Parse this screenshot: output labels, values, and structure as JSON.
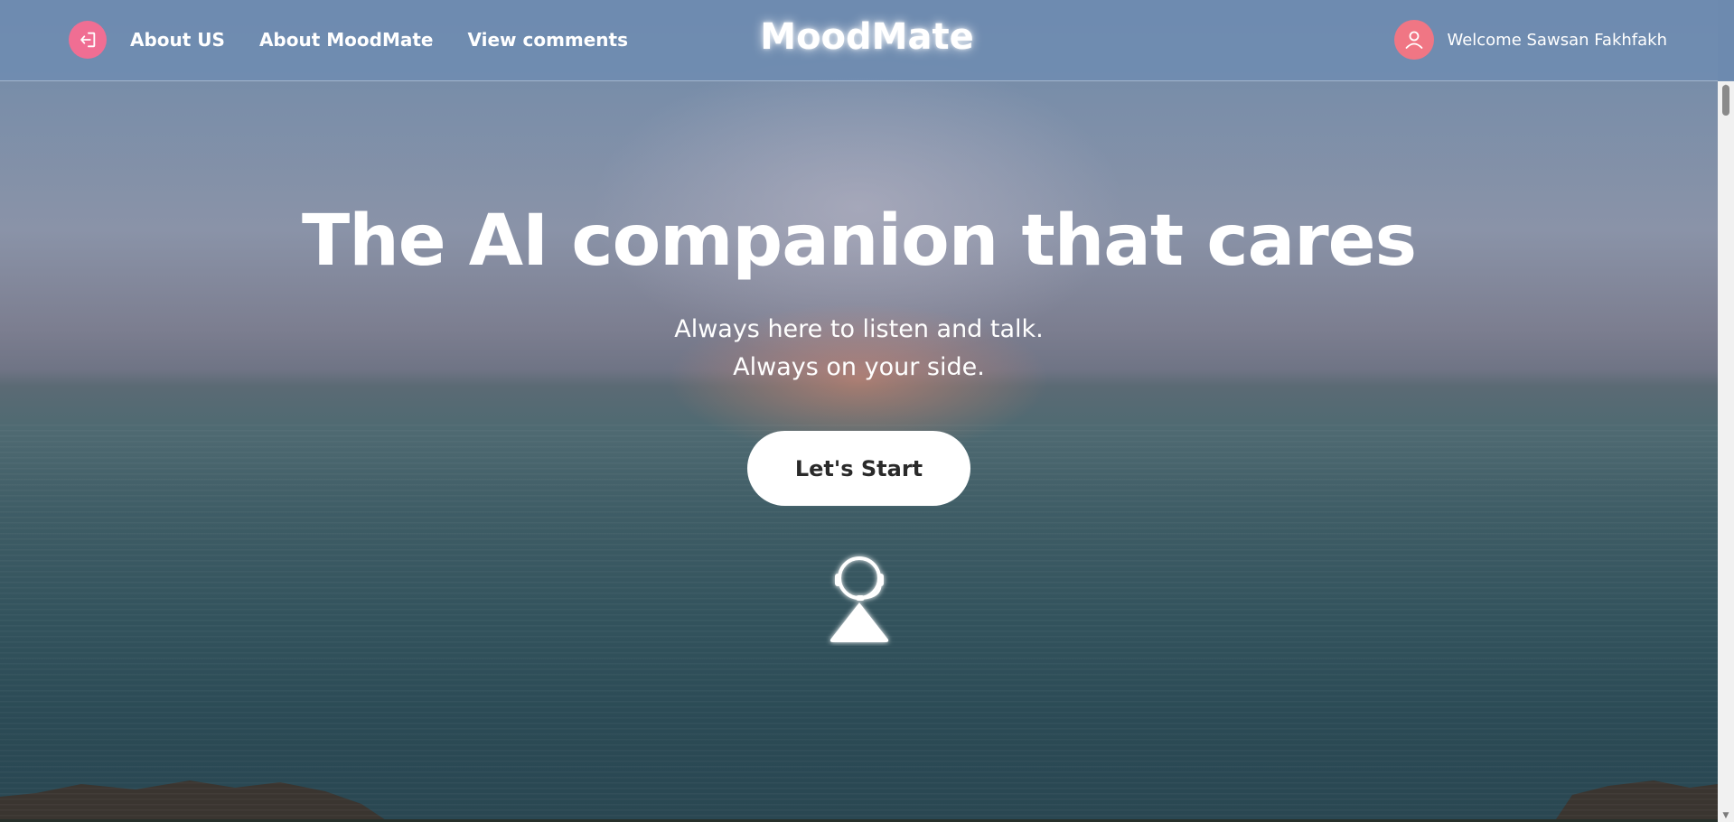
{
  "navbar": {
    "brand": "MoodMate",
    "links": [
      {
        "label": "About US"
      },
      {
        "label": "About MoodMate"
      },
      {
        "label": "View comments"
      }
    ],
    "welcome_text": "Welcome Sawsan Fakhfakh",
    "logout_icon": "logout-icon",
    "avatar_icon": "user-icon"
  },
  "hero": {
    "title": "The AI companion that cares",
    "subtitle_line1": "Always here to listen and talk.",
    "subtitle_line2": "Always on your side.",
    "cta_label": "Let's Start",
    "assistant_icon": "headset-assistant-icon"
  },
  "colors": {
    "accent_pink": "#f06e93",
    "avatar_pink": "#f07684",
    "navbar_bg": "#6e8cb2",
    "button_bg": "#ffffff"
  }
}
